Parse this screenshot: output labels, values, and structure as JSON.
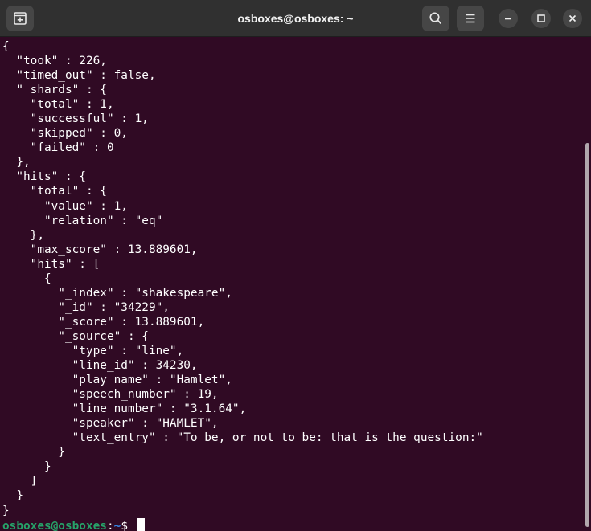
{
  "window": {
    "title": "osboxes@osboxes: ~"
  },
  "colors": {
    "terminal_background": "#300a24",
    "titlebar_background": "#303030",
    "prompt_user_color": "#26a269",
    "prompt_path_color": "#3584e4",
    "text_color": "#ffffff"
  },
  "icons": {
    "new_tab": "new-tab-icon",
    "search": "search-icon",
    "menu": "hamburger-menu-icon",
    "minimize": "minimize-icon",
    "maximize": "maximize-icon",
    "close": "close-icon"
  },
  "terminal": {
    "lines": [
      "{",
      "  \"took\" : 226,",
      "  \"timed_out\" : false,",
      "  \"_shards\" : {",
      "    \"total\" : 1,",
      "    \"successful\" : 1,",
      "    \"skipped\" : 0,",
      "    \"failed\" : 0",
      "  },",
      "  \"hits\" : {",
      "    \"total\" : {",
      "      \"value\" : 1,",
      "      \"relation\" : \"eq\"",
      "    },",
      "    \"max_score\" : 13.889601,",
      "    \"hits\" : [",
      "      {",
      "        \"_index\" : \"shakespeare\",",
      "        \"_id\" : \"34229\",",
      "        \"_score\" : 13.889601,",
      "        \"_source\" : {",
      "          \"type\" : \"line\",",
      "          \"line_id\" : 34230,",
      "          \"play_name\" : \"Hamlet\",",
      "          \"speech_number\" : 19,",
      "          \"line_number\" : \"3.1.64\",",
      "          \"speaker\" : \"HAMLET\",",
      "          \"text_entry\" : \"To be, or not to be: that is the question:\"",
      "        }",
      "      }",
      "    ]",
      "  }",
      "}"
    ],
    "prompt": {
      "user_host": "osboxes@osboxes",
      "separator": ":",
      "path": "~",
      "symbol": "$ "
    }
  }
}
